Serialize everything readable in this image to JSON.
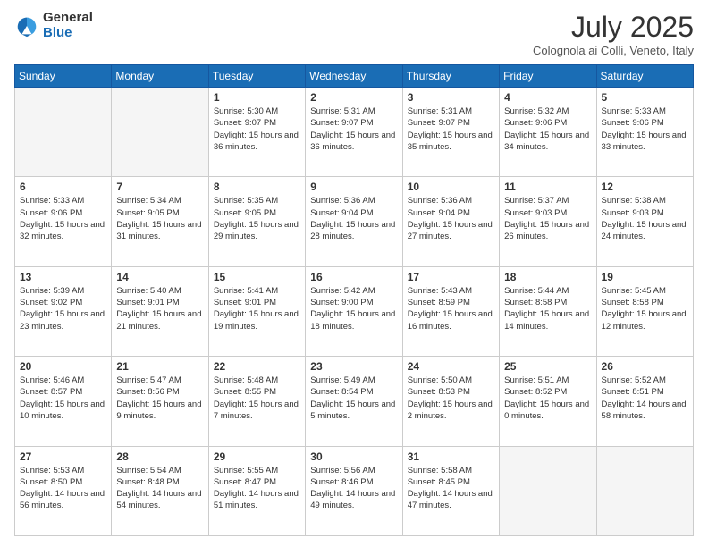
{
  "header": {
    "logo_general": "General",
    "logo_blue": "Blue",
    "month_title": "July 2025",
    "location": "Colognola ai Colli, Veneto, Italy"
  },
  "days_of_week": [
    "Sunday",
    "Monday",
    "Tuesday",
    "Wednesday",
    "Thursday",
    "Friday",
    "Saturday"
  ],
  "weeks": [
    [
      {
        "day": "",
        "info": ""
      },
      {
        "day": "",
        "info": ""
      },
      {
        "day": "1",
        "info": "Sunrise: 5:30 AM\nSunset: 9:07 PM\nDaylight: 15 hours and 36 minutes."
      },
      {
        "day": "2",
        "info": "Sunrise: 5:31 AM\nSunset: 9:07 PM\nDaylight: 15 hours and 36 minutes."
      },
      {
        "day": "3",
        "info": "Sunrise: 5:31 AM\nSunset: 9:07 PM\nDaylight: 15 hours and 35 minutes."
      },
      {
        "day": "4",
        "info": "Sunrise: 5:32 AM\nSunset: 9:06 PM\nDaylight: 15 hours and 34 minutes."
      },
      {
        "day": "5",
        "info": "Sunrise: 5:33 AM\nSunset: 9:06 PM\nDaylight: 15 hours and 33 minutes."
      }
    ],
    [
      {
        "day": "6",
        "info": "Sunrise: 5:33 AM\nSunset: 9:06 PM\nDaylight: 15 hours and 32 minutes."
      },
      {
        "day": "7",
        "info": "Sunrise: 5:34 AM\nSunset: 9:05 PM\nDaylight: 15 hours and 31 minutes."
      },
      {
        "day": "8",
        "info": "Sunrise: 5:35 AM\nSunset: 9:05 PM\nDaylight: 15 hours and 29 minutes."
      },
      {
        "day": "9",
        "info": "Sunrise: 5:36 AM\nSunset: 9:04 PM\nDaylight: 15 hours and 28 minutes."
      },
      {
        "day": "10",
        "info": "Sunrise: 5:36 AM\nSunset: 9:04 PM\nDaylight: 15 hours and 27 minutes."
      },
      {
        "day": "11",
        "info": "Sunrise: 5:37 AM\nSunset: 9:03 PM\nDaylight: 15 hours and 26 minutes."
      },
      {
        "day": "12",
        "info": "Sunrise: 5:38 AM\nSunset: 9:03 PM\nDaylight: 15 hours and 24 minutes."
      }
    ],
    [
      {
        "day": "13",
        "info": "Sunrise: 5:39 AM\nSunset: 9:02 PM\nDaylight: 15 hours and 23 minutes."
      },
      {
        "day": "14",
        "info": "Sunrise: 5:40 AM\nSunset: 9:01 PM\nDaylight: 15 hours and 21 minutes."
      },
      {
        "day": "15",
        "info": "Sunrise: 5:41 AM\nSunset: 9:01 PM\nDaylight: 15 hours and 19 minutes."
      },
      {
        "day": "16",
        "info": "Sunrise: 5:42 AM\nSunset: 9:00 PM\nDaylight: 15 hours and 18 minutes."
      },
      {
        "day": "17",
        "info": "Sunrise: 5:43 AM\nSunset: 8:59 PM\nDaylight: 15 hours and 16 minutes."
      },
      {
        "day": "18",
        "info": "Sunrise: 5:44 AM\nSunset: 8:58 PM\nDaylight: 15 hours and 14 minutes."
      },
      {
        "day": "19",
        "info": "Sunrise: 5:45 AM\nSunset: 8:58 PM\nDaylight: 15 hours and 12 minutes."
      }
    ],
    [
      {
        "day": "20",
        "info": "Sunrise: 5:46 AM\nSunset: 8:57 PM\nDaylight: 15 hours and 10 minutes."
      },
      {
        "day": "21",
        "info": "Sunrise: 5:47 AM\nSunset: 8:56 PM\nDaylight: 15 hours and 9 minutes."
      },
      {
        "day": "22",
        "info": "Sunrise: 5:48 AM\nSunset: 8:55 PM\nDaylight: 15 hours and 7 minutes."
      },
      {
        "day": "23",
        "info": "Sunrise: 5:49 AM\nSunset: 8:54 PM\nDaylight: 15 hours and 5 minutes."
      },
      {
        "day": "24",
        "info": "Sunrise: 5:50 AM\nSunset: 8:53 PM\nDaylight: 15 hours and 2 minutes."
      },
      {
        "day": "25",
        "info": "Sunrise: 5:51 AM\nSunset: 8:52 PM\nDaylight: 15 hours and 0 minutes."
      },
      {
        "day": "26",
        "info": "Sunrise: 5:52 AM\nSunset: 8:51 PM\nDaylight: 14 hours and 58 minutes."
      }
    ],
    [
      {
        "day": "27",
        "info": "Sunrise: 5:53 AM\nSunset: 8:50 PM\nDaylight: 14 hours and 56 minutes."
      },
      {
        "day": "28",
        "info": "Sunrise: 5:54 AM\nSunset: 8:48 PM\nDaylight: 14 hours and 54 minutes."
      },
      {
        "day": "29",
        "info": "Sunrise: 5:55 AM\nSunset: 8:47 PM\nDaylight: 14 hours and 51 minutes."
      },
      {
        "day": "30",
        "info": "Sunrise: 5:56 AM\nSunset: 8:46 PM\nDaylight: 14 hours and 49 minutes."
      },
      {
        "day": "31",
        "info": "Sunrise: 5:58 AM\nSunset: 8:45 PM\nDaylight: 14 hours and 47 minutes."
      },
      {
        "day": "",
        "info": ""
      },
      {
        "day": "",
        "info": ""
      }
    ]
  ]
}
